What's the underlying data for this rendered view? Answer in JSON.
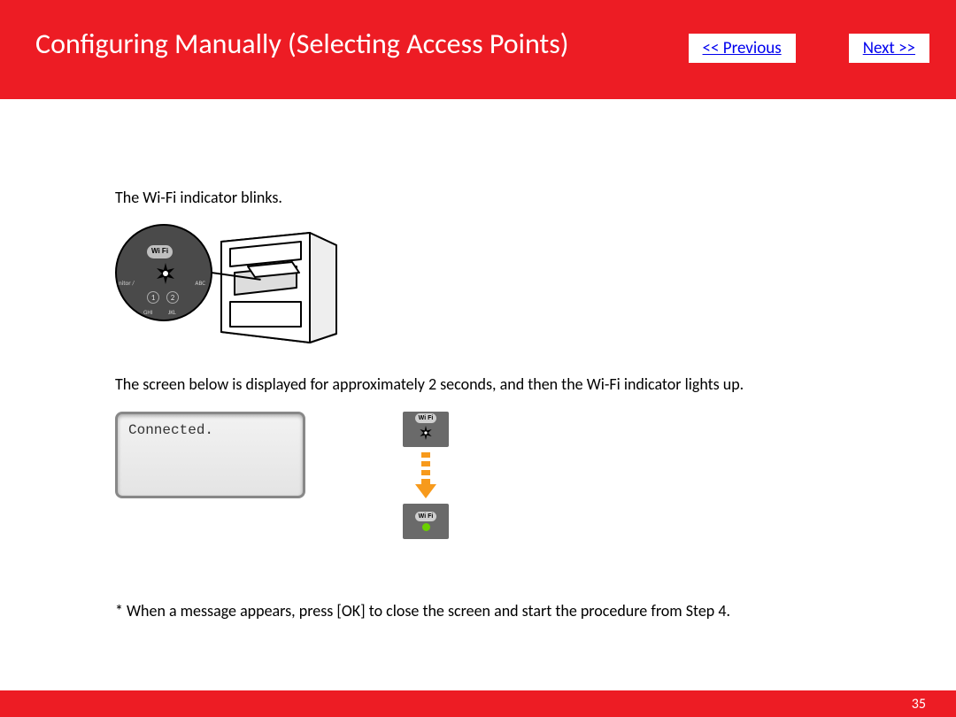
{
  "header": {
    "title": "Configuring Manually (Selecting Access Points)",
    "prev_label": "<< Previous",
    "next_label": "Next >>"
  },
  "body": {
    "line1": "The Wi-Fi indicator blinks.",
    "line2": "The screen below is displayed for approximately 2 seconds, and then the Wi-Fi indicator lights up.",
    "lcd_text": "Connected.",
    "note": "* When a message appears, press [OK] to close the screen and start the procedure from Step 4.",
    "wifi_label": "Wi Fi",
    "dial_nums": [
      "1",
      "2"
    ],
    "dial_side_labels": [
      "nitor /",
      "ABC",
      "GHI",
      "JKL"
    ]
  },
  "footer": {
    "page_number": "35"
  },
  "colors": {
    "brand_red": "#ed1c24",
    "link_blue": "#0000ee",
    "arrow_orange": "#f79a1c",
    "led_green": "#6bd100"
  }
}
